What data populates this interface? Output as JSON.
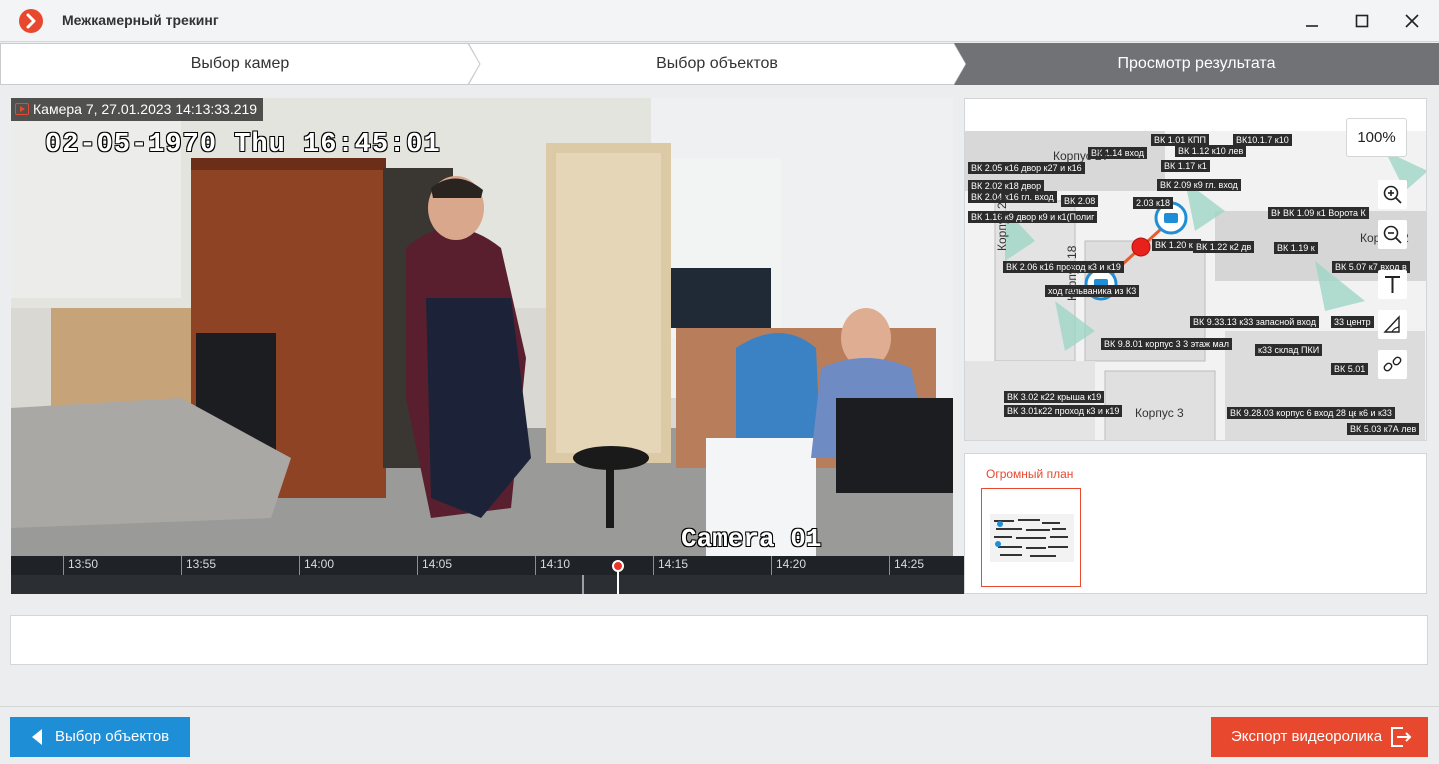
{
  "window": {
    "title": "Межкамерный трекинг",
    "controls": [
      "minimize-icon",
      "maximize-icon",
      "close-icon"
    ]
  },
  "steps": [
    {
      "label": "Выбор камер",
      "state": "done"
    },
    {
      "label": "Выбор объектов",
      "state": "done"
    },
    {
      "label": "Просмотр результата",
      "state": "active"
    }
  ],
  "video": {
    "camera_label": "Камера 7, 27.01.2023 14:13:33.219",
    "osd_timestamp": "02-05-1970 Thu 16:45:01",
    "osd_camera": "Camera 01"
  },
  "timeline": {
    "ticks": [
      "13:50",
      "13:55",
      "14:00",
      "14:05",
      "14:10",
      "14:15",
      "14:20",
      "14:25"
    ],
    "playhead_time": "14:13:33"
  },
  "map": {
    "zoom": "100%",
    "labels": [
      "Корпус 2?",
      "Корпус 21",
      "Корпус 3",
      "Корпус 2",
      "Корпус 18",
      "ВК 1.14 вход",
      "ВК 1.01 КПП",
      "ВК 1.12 к10 лев",
      "ВК 1.17 к1",
      "ВК10.1.7 к10",
      "ВК 2.05 к16 двор к27 и к16",
      "ВК 2.02 к18 двор",
      "ВК 2.08",
      "ВК 2.09 к9 гл. вход",
      "2.03 к18",
      "ВК 2.04 к16 гл. вход",
      "ВК 1.16 к9 двор к9 и к1(Полиг",
      "ВК 1.23",
      "ВК 1.09 к1 Ворота К",
      "ВК 1.19 к",
      "ВК 1.20 к2",
      "ВК 1.22 к2 дв",
      "ВК 2.06 к16 проход к3 и к19",
      "ВК 5.07 к7 вход в",
      "ход гальваника из К3",
      "ВК 9.33.13 к33 запасной вход",
      "33 центр",
      "ВК 9.8.01 корпус 3 3 этаж мал",
      "к33 склад ПКИ",
      "ВК 5.01",
      "ВК 3.02 к22 крыша к19",
      "ВК 3.01к22 проход к3 и к19",
      "ВК 9.28.03 корпус 6 вход 28 цех",
      "к6 и к33",
      "ВК 5.03 к7А лев"
    ],
    "tools": [
      "zoom-in-icon",
      "zoom-out-icon",
      "text-tool-icon",
      "ruler-icon",
      "link-icon"
    ]
  },
  "plans": {
    "items": [
      {
        "name": "Огромный план",
        "selected": true
      }
    ]
  },
  "footer": {
    "back_label": "Выбор объектов",
    "export_label": "Экспорт видеоролика"
  },
  "colors": {
    "accent": "#e8492e",
    "primary": "#1e8fd6",
    "active_step": "#707275"
  }
}
